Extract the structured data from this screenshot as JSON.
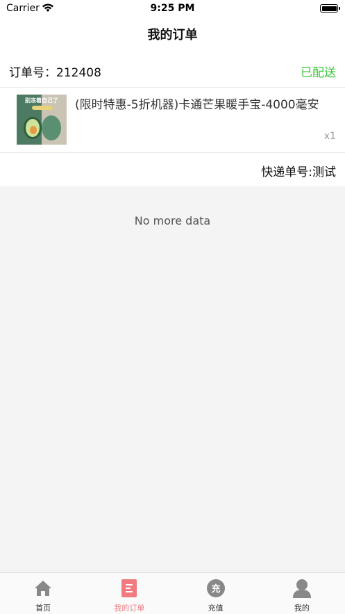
{
  "status_bar": {
    "carrier": "Carrier",
    "time": "9:25 PM"
  },
  "nav": {
    "title": "我的订单"
  },
  "order": {
    "order_number": "订单号：212408",
    "status": "已配送",
    "status_color": "#3ac63a",
    "product": {
      "title": "(限时特惠-5折机器)卡通芒果暖手宝-4000毫安",
      "quantity": "x1",
      "thumbnail_text": "别冻着自己了"
    },
    "tracking": "快递单号:测试"
  },
  "list_footer": "No more data",
  "tab_bar": {
    "active_color": "#f07a80",
    "tabs": [
      {
        "label": "首页",
        "icon": "home-icon"
      },
      {
        "label": "我的订单",
        "icon": "orders-icon"
      },
      {
        "label": "充值",
        "icon": "recharge-icon"
      },
      {
        "label": "我的",
        "icon": "profile-icon"
      }
    ]
  }
}
